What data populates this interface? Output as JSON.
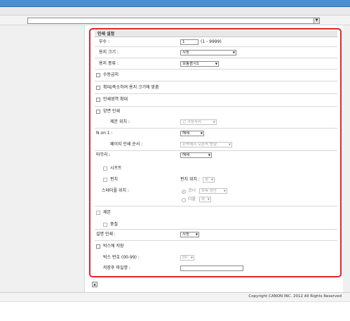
{
  "toolbar": {
    "url_value": ""
  },
  "panel": {
    "title": "인쇄 설정",
    "copies": {
      "label": "부수 :",
      "value": "1",
      "range": "(1 - 9999)"
    },
    "paper_size": {
      "label": "용지 크기 :",
      "value": "자동"
    },
    "paper_type": {
      "label": "용지 종류 :",
      "value": "보통용지1"
    },
    "manual_feed": {
      "label": "수동급지"
    },
    "fit_to_paper": {
      "label": "확대/축소하여 용지 크기에 맞춤"
    },
    "enlarge_print_area": {
      "label": "인쇄영역 확대"
    },
    "duplex": {
      "label": "양면 인쇄"
    },
    "binding_position": {
      "label": "제본 위치 :",
      "value": "긴 가장자리"
    },
    "n_on_1": {
      "label": "N on 1 :",
      "value": "해제"
    },
    "page_layout_order": {
      "label": "페이지 인쇄 순서 :",
      "value": "왼쪽에서 오른쪽 방향"
    },
    "finishing": {
      "label": "마무리 :",
      "value": "해제"
    },
    "sort": {
      "label": "시프트"
    },
    "punch": {
      "label": "펀치",
      "position_label": "펀치 위치 :",
      "position_value": "좌"
    },
    "staple_position": {
      "label": "스테이플 위치 :",
      "corner_label": "코너",
      "corner_value": "좌측 상단",
      "double_label": "더블",
      "double_value": "좌"
    },
    "booklet": {
      "label": "제본"
    },
    "saddle": {
      "label": "중철"
    },
    "collate": {
      "label": "설명 인쇄 :",
      "value": "자동"
    },
    "store_to_box": {
      "label": "박스에 저장"
    },
    "box_number": {
      "label": "박스 번호 (00-99) :",
      "value": "00"
    },
    "file_name": {
      "label": "저장후 파일명 :",
      "value": ""
    }
  },
  "footer": {
    "copyright": "Copyright CANON INC. 2012 All Rights Reserved"
  },
  "icons": {
    "scroll_top": "up-arrow-icon",
    "dropdown": "chevron-down-icon"
  },
  "colors": {
    "highlight_border": "#e0252e",
    "top_bar": "#4a8fd1"
  }
}
